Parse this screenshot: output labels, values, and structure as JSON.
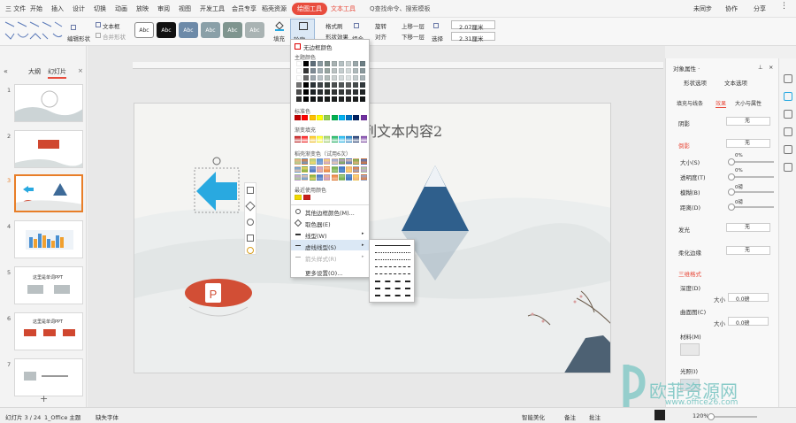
{
  "menubar": {
    "items": [
      "三 文件",
      "开始",
      "插入",
      "设计",
      "切换",
      "动画",
      "放映",
      "审阅",
      "视图",
      "开发工具",
      "会员专享",
      "稻壳资源"
    ],
    "tool_tab": "绘图工具",
    "text_tab": "文本工具",
    "search": "Q查找命令、搜索模板",
    "right": [
      "未同步",
      "协作",
      "分享"
    ]
  },
  "ribbon": {
    "edit_shape": "编辑形状",
    "textbox": "文本框",
    "merge_shape": "合并形状",
    "styles": [
      "Abc",
      "Abc",
      "Abc",
      "Abc",
      "Abc",
      "Abc"
    ],
    "fill": "填充",
    "outline": "轮廓",
    "format_painter": "格式刷",
    "shape_effect": "形状效果",
    "group": "组合",
    "rotate": "旋转",
    "align": "对齐",
    "up": "上移一层",
    "down": "下移一层",
    "select": "选择",
    "height": "2.07厘米",
    "width": "2.31厘米"
  },
  "leftpanel": {
    "tab_outline": "大纲",
    "tab_slides": "幻灯片",
    "thumb_numbers": [
      "1",
      "2",
      "3",
      "4",
      "5",
      "6",
      "7"
    ],
    "thumb5_title": "这里是单词PPT",
    "thumb6_title": "这里是单词PPT",
    "add": "+"
  },
  "slide": {
    "title": "列文本内容2"
  },
  "dropdown": {
    "no_outline": "无边框颜色",
    "theme_colors": "主题颜色",
    "standard_colors": "标准色",
    "gradient": "渐变填充",
    "gradient_colors": "稻壳渐变色（试用6次）",
    "recent": "最近使用颜色",
    "more_colors": "其他边框颜色(M)...",
    "eyedropper": "取色器(E)",
    "line_weight": "线型(W)",
    "dash_type": "虚线线型(S)",
    "arrow_style": "箭头样式(R)",
    "more_settings": "更多设置(O)..."
  },
  "rightpanel": {
    "title": "对象属性 ·",
    "tab_shape": "形状选项",
    "tab_text": "文本选项",
    "sub_fill": "填充与线条",
    "sub_effect": "效果",
    "sub_size": "大小与属性",
    "shadow": "阴影",
    "shadow_val": "无",
    "reflection": "倒影",
    "reflection_val": "无",
    "size": "大小(S)",
    "transparency": "透明度(T)",
    "blur": "模糊(B)",
    "distance": "距离(D)",
    "pct0": "0%",
    "pct_0": "0%",
    "pt0": "0磅",
    "pt_0": "0磅",
    "glow": "发光",
    "glow_val": "无",
    "soft": "柔化边缘",
    "soft_val": "无",
    "three_d": "三维格式",
    "depth": "深度(D)",
    "depth_size": "大小",
    "depth_val": "0.0磅",
    "contour": "曲面图(C)",
    "contour_size": "大小",
    "contour_val": "0.0磅",
    "material": "材料(M)",
    "lighting": "光照(I)"
  },
  "statusbar": {
    "slide_count": "幻灯片 3 / 24",
    "theme": "1_Office 主题",
    "font_missing": "缺失字体",
    "smart": "智能美化",
    "notes": "备注",
    "comments": "批注",
    "zoom": "120%"
  },
  "watermark": {
    "brand": "欧菲资源网",
    "url": "www.office26.com"
  },
  "colors": {
    "accent": "#e84c3d",
    "shape_blue": "#29a9e0"
  }
}
